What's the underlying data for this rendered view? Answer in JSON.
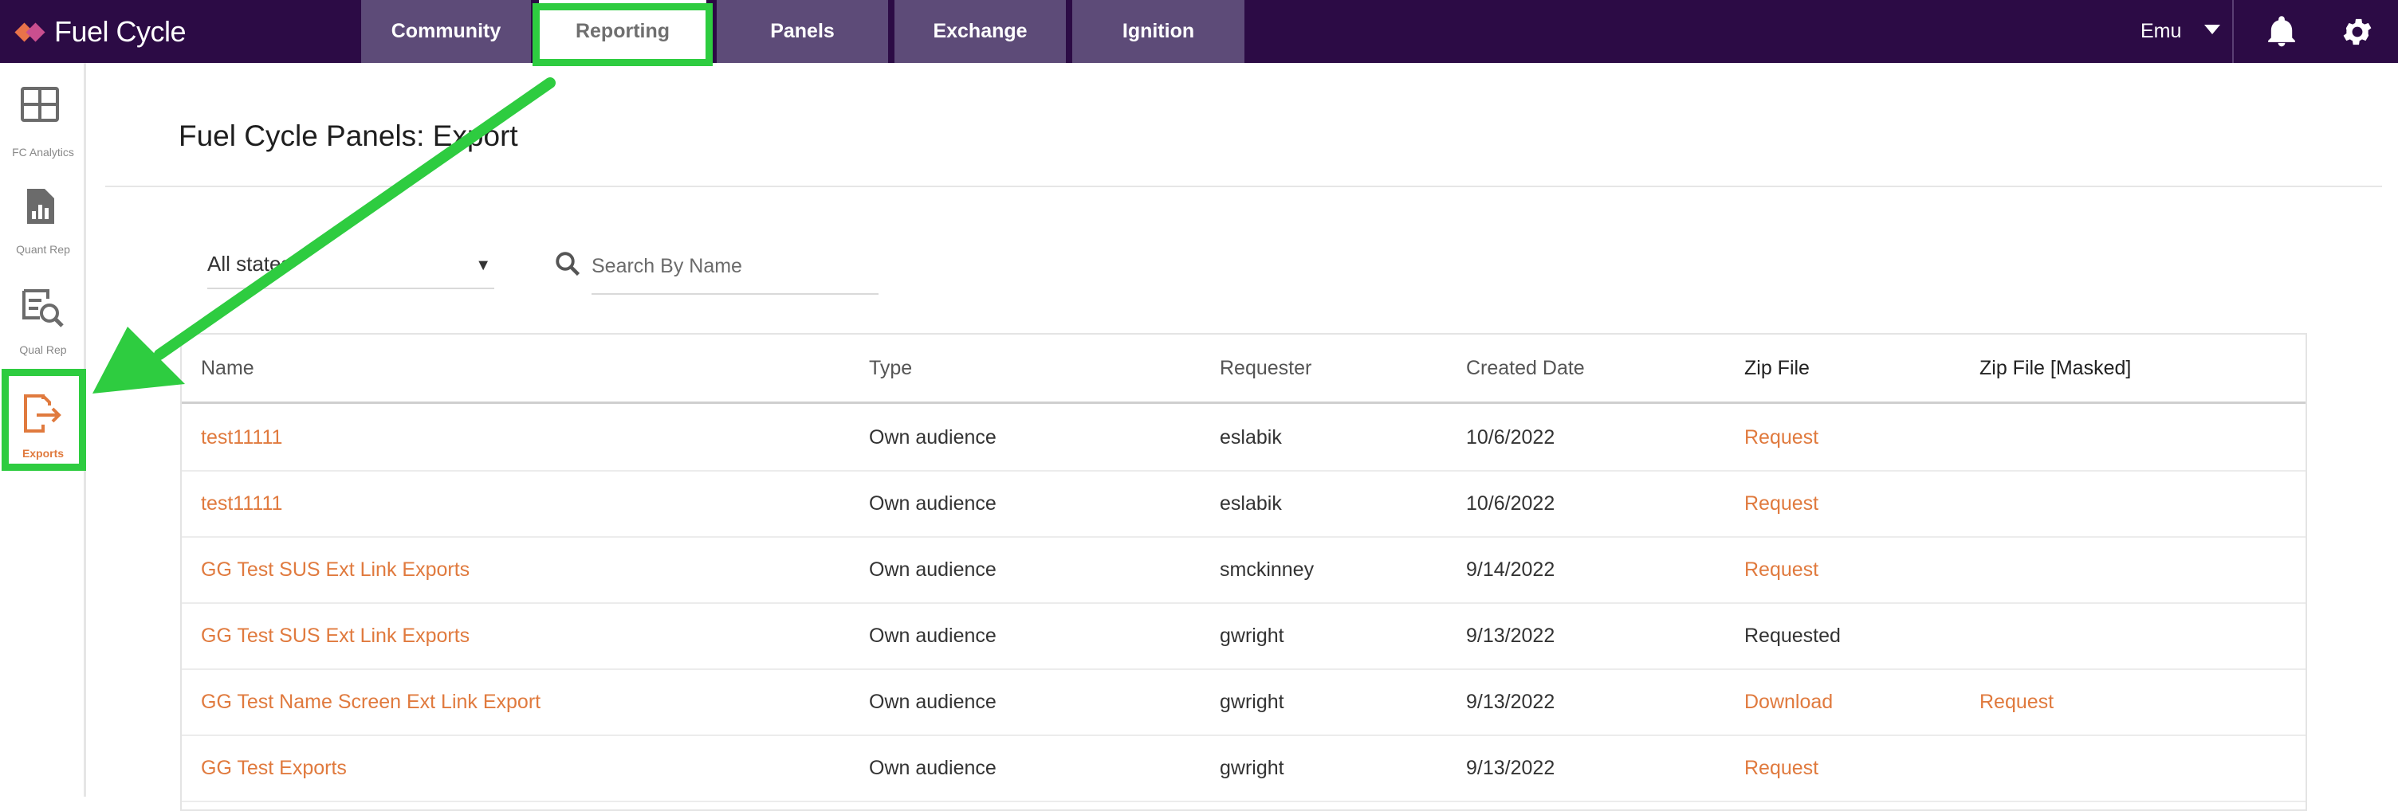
{
  "app": {
    "name": "Fuel Cycle"
  },
  "nav": {
    "tabs": [
      {
        "label": "Community"
      },
      {
        "label": "Reporting"
      },
      {
        "label": "Panels"
      },
      {
        "label": "Exchange"
      },
      {
        "label": "Ignition"
      }
    ],
    "active_tab": "Reporting",
    "user": "Emu"
  },
  "sidebar": {
    "items": [
      {
        "label": "FC Analytics",
        "icon": "grid-icon"
      },
      {
        "label": "Quant Rep",
        "icon": "bar-chart-icon"
      },
      {
        "label": "Qual Rep",
        "icon": "document-search-icon"
      },
      {
        "label": "Exports",
        "icon": "export-icon"
      }
    ],
    "active_item": "Exports"
  },
  "page": {
    "title": "Fuel Cycle Panels: Export"
  },
  "filters": {
    "status_value": "All states",
    "search_placeholder": "Search By Name"
  },
  "table": {
    "columns": [
      "Name",
      "Type",
      "Requester",
      "Created Date",
      "Zip File",
      "Zip File [Masked]"
    ],
    "rows": [
      {
        "name": "test11111",
        "type": "Own audience",
        "requester": "eslabik",
        "created": "10/6/2022",
        "zip": "Request",
        "zip_masked": ""
      },
      {
        "name": "test11111",
        "type": "Own audience",
        "requester": "eslabik",
        "created": "10/6/2022",
        "zip": "Request",
        "zip_masked": ""
      },
      {
        "name": "GG Test SUS Ext Link Exports",
        "type": "Own audience",
        "requester": "smckinney",
        "created": "9/14/2022",
        "zip": "Request",
        "zip_masked": ""
      },
      {
        "name": "GG Test SUS Ext Link Exports",
        "type": "Own audience",
        "requester": "gwright",
        "created": "9/13/2022",
        "zip": "Requested",
        "zip_masked": ""
      },
      {
        "name": "GG Test Name Screen Ext Link Export",
        "type": "Own audience",
        "requester": "gwright",
        "created": "9/13/2022",
        "zip": "Download",
        "zip_masked": "Request"
      },
      {
        "name": "GG Test Exports",
        "type": "Own audience",
        "requester": "gwright",
        "created": "9/13/2022",
        "zip": "Request",
        "zip_masked": ""
      }
    ]
  },
  "colors": {
    "topbar": "#2c0b45",
    "tab": "#5d4b78",
    "accent": "#e07a3e",
    "highlight": "#2ecc40"
  }
}
